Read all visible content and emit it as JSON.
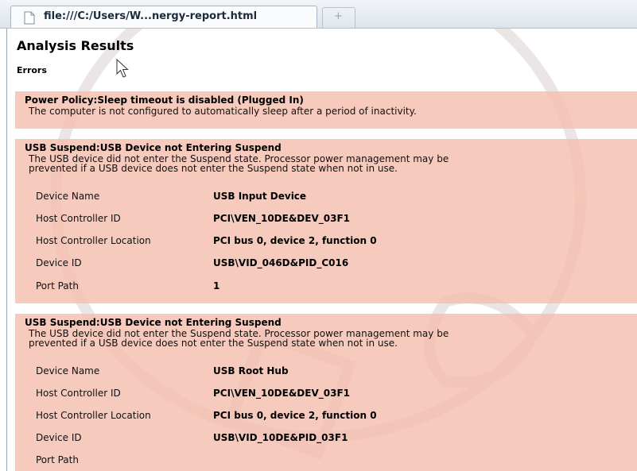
{
  "browser": {
    "tab_title": "file:///C:/Users/W...nergy-report.html",
    "new_tab_label": "+"
  },
  "page": {
    "title": "Analysis Results",
    "section": "Errors"
  },
  "cards": [
    {
      "title": "Power Policy:Sleep timeout is disabled (Plugged In)",
      "description": "The computer is not configured to automatically sleep after a period of inactivity.",
      "rows": []
    },
    {
      "title": "USB Suspend:USB Device not Entering Suspend",
      "description": "The USB device did not enter the Suspend state. Processor power management may be\nprevented if a USB device does not enter the Suspend state when not in use.",
      "rows": [
        {
          "label": "Device Name",
          "value": "USB Input Device"
        },
        {
          "label": "Host Controller ID",
          "value": "PCI\\VEN_10DE&DEV_03F1"
        },
        {
          "label": "Host Controller Location",
          "value": "PCI bus 0, device 2, function 0"
        },
        {
          "label": "Device ID",
          "value": "USB\\VID_046D&PID_C016"
        },
        {
          "label": "Port Path",
          "value": "1"
        }
      ]
    },
    {
      "title": "USB Suspend:USB Device not Entering Suspend",
      "description": "The USB device did not enter the Suspend state. Processor power management may be\nprevented if a USB device does not enter the Suspend state when not in use.",
      "rows": [
        {
          "label": "Device Name",
          "value": "USB Root Hub"
        },
        {
          "label": "Host Controller ID",
          "value": "PCI\\VEN_10DE&DEV_03F1"
        },
        {
          "label": "Host Controller Location",
          "value": "PCI bus 0, device 2, function 0"
        },
        {
          "label": "Device ID",
          "value": "USB\\VID_10DE&PID_03F1"
        },
        {
          "label": "Port Path",
          "value": ""
        }
      ]
    }
  ],
  "colors": {
    "error_card": "#f4beaf",
    "page_background": "#ffffff"
  }
}
